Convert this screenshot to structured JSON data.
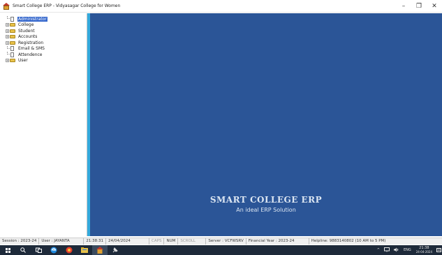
{
  "window": {
    "title": "Smart College ERP - Vidyasagar College for Women",
    "controls": {
      "minimize": "–",
      "restore": "❐",
      "close": "✕"
    }
  },
  "tree": {
    "items": [
      {
        "label": "Administrator",
        "type": "doc",
        "expandable": false,
        "selected": true
      },
      {
        "label": "College",
        "type": "folder",
        "expandable": true,
        "selected": false
      },
      {
        "label": "Student",
        "type": "folder",
        "expandable": true,
        "selected": false
      },
      {
        "label": "Accounts",
        "type": "folder",
        "expandable": true,
        "selected": false
      },
      {
        "label": "Registration",
        "type": "folder",
        "expandable": true,
        "selected": false
      },
      {
        "label": "Email & SMS",
        "type": "doc",
        "expandable": false,
        "selected": false
      },
      {
        "label": "Attendence",
        "type": "doc",
        "expandable": false,
        "selected": false
      },
      {
        "label": "User",
        "type": "folder",
        "expandable": true,
        "selected": false
      }
    ]
  },
  "main": {
    "brand_title": "SMART COLLEGE ERP",
    "brand_subtitle": "An ideal ERP Solution"
  },
  "status": {
    "session": "Session : 2023-24",
    "user": "User : JAYANTA",
    "time": "21:38:31",
    "date": "24/04/2024",
    "caps": "CAPS",
    "num": "NUM",
    "scroll": "SCROLL",
    "server": "Server : VCFWSRV",
    "financial_year": "Financial Year : 2023-24",
    "helpline": "Helpline: 9883140802  (10 AM to 5 PM)"
  },
  "taskbar": {
    "icons": [
      "windows-start-icon",
      "search-icon",
      "task-view-icon",
      "edge-icon",
      "app-icon",
      "file-explorer-icon",
      "erp-app-icon",
      "pin-icon"
    ],
    "tray": {
      "up_arrow": "^",
      "language": "ENG",
      "clock_time": "21:38",
      "clock_date": "24-04-2024"
    }
  },
  "colors": {
    "main_bg": "#2b5597",
    "splitter": "#33aadd",
    "selected": "#3366cc",
    "taskbar": "#1e2a3a"
  }
}
